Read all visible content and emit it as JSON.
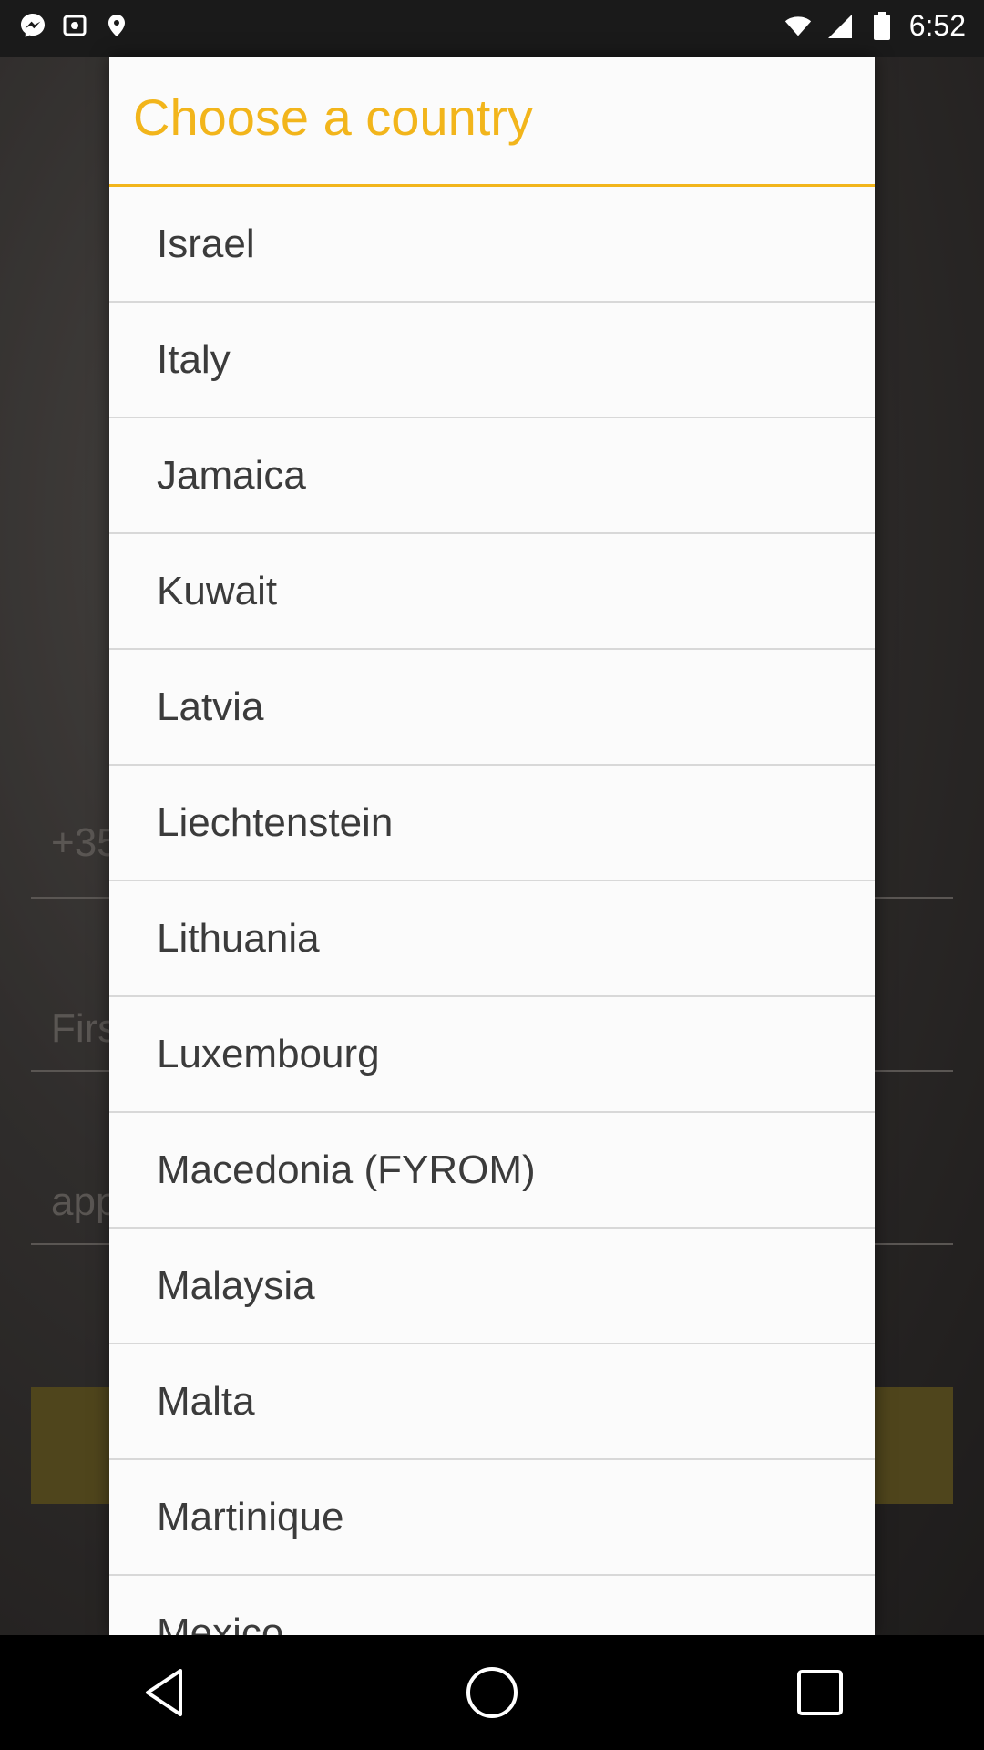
{
  "status_bar": {
    "time": "6:52",
    "left_icons": [
      "messenger-icon",
      "notification-icon",
      "location-icon"
    ],
    "right_icons": [
      "wifi-icon",
      "signal-icon",
      "battery-icon"
    ]
  },
  "background_form": {
    "phone_prefix": "+35",
    "first_name_placeholder": "Firs",
    "app_field_placeholder": "app"
  },
  "dialog": {
    "title": "Choose a country",
    "countries": [
      "Israel",
      "Italy",
      "Jamaica",
      "Kuwait",
      "Latvia",
      "Liechtenstein",
      "Lithuania",
      "Luxembourg",
      "Macedonia (FYROM)",
      "Malaysia",
      "Malta",
      "Martinique",
      "Mexico"
    ]
  },
  "nav_bar": {
    "buttons": [
      "back-icon",
      "home-icon",
      "recents-icon"
    ]
  },
  "colors": {
    "accent": "#f2b51b",
    "dialog_bg": "#fbfbfb",
    "item_text": "#3b3b3b",
    "divider": "#d8d8d8"
  }
}
